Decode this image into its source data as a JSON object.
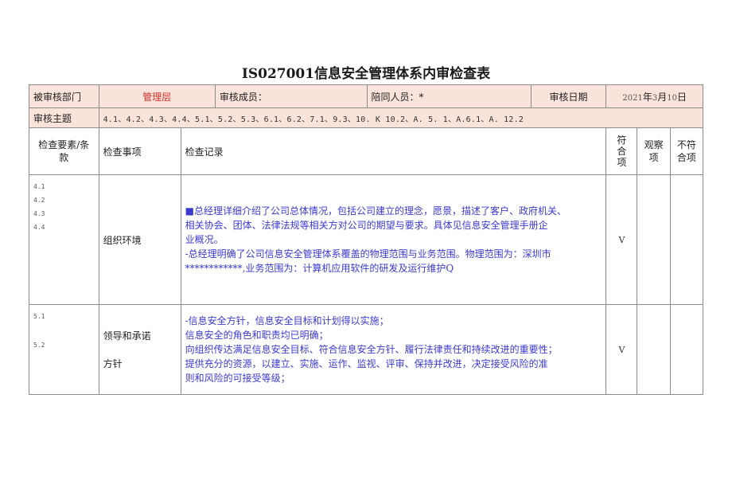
{
  "title": "IS027001信息安全管理体系内审检查表",
  "info": {
    "dept_label": "被审核部门",
    "dept_value": "管理层",
    "members_label": "审核成员：",
    "companion_label": "陪同人员：*",
    "date_label": "审核日期",
    "date_value": {
      "year": "2021",
      "y_char": "年",
      "month": "3",
      "m_char": "月",
      "day": "10",
      "d_char": "日"
    }
  },
  "theme": {
    "label": "审核主题",
    "value": "4.1、4.2、4.3、4.4、5.1、5.2、5.3、6.1、6.2、7.1、9.3、10. K 10.2、A. 5. 1、A.6.1、A. 12.2"
  },
  "headers": {
    "element": "检查要素/条款",
    "item": "检查事项",
    "record": "检查记录",
    "conform": "符合项",
    "observe": "观察项",
    "nonconform": "不符合项"
  },
  "rows": [
    {
      "clauses": [
        "4.1",
        "4.2",
        "4.3",
        "4.4"
      ],
      "item": "组织环境",
      "record_lines": [
        "■总经理详细介绍了公司总体情况，包括公司建立的理念，愿景，描述了客户、政府机关、",
        "相关协会、团体、法律法规等相关方对公司的期望与要求。具体见信息安全管理手册企",
        "业概况。",
        "-总经理明确了公司信息安全管理体系覆盖的物理范围与业务范围。物理范围为：深圳市",
        "************,业务范围为：计算机应用软件的研发及运行维护Q"
      ],
      "conform_mark": "V"
    },
    {
      "clauses": [
        "5.1",
        "5.2"
      ],
      "item_lines": [
        "领导和承诺",
        "方针"
      ],
      "record_lines": [
        "-信息安全方针，信息安全目标和计划得以实施；",
        "信息安全的角色和职责均已明确；",
        "向组织传达满足信息安全目标、符合信息安全方针、履行法律责任和持续改进的重要性；",
        "提供充分的资源，以建立、实施、运作、监视、评审、保持并改进，决定接受风险的准",
        "则和风险的可接受等级；"
      ],
      "conform_mark": "V"
    }
  ]
}
